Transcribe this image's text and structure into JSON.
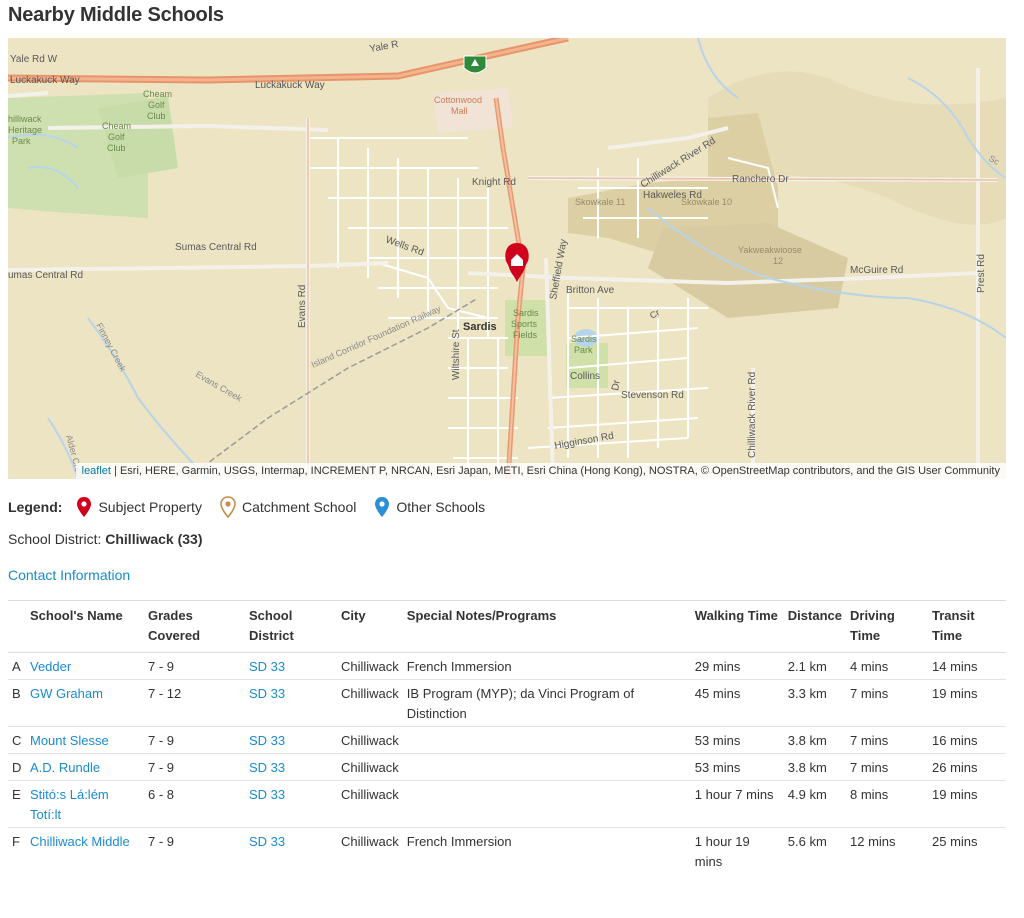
{
  "page": {
    "title": "Nearby Middle Schools"
  },
  "map": {
    "attribution_link": "leaflet",
    "attribution_text": " | Esri, HERE, Garmin, USGS, Intermap, INCREMENT P, NRCAN, Esri Japan, METI, Esri China (Hong Kong), NOSTRA, © OpenStreetMap contributors, and the GIS User Community",
    "labels": {
      "yale_rd_w": "Yale Rd W",
      "yale_rd": "Yale R",
      "luckakuck_way_left": "Luckakuck Way",
      "luckakuck_way": "Luckakuck Way",
      "cheam_golf_club_1": [
        "Cheam",
        "Golf",
        "Club"
      ],
      "cheam_golf_club_2": [
        "Cheam",
        "Golf",
        "Club"
      ],
      "heritage_park": [
        "hilliwack",
        "Heritage",
        "Park"
      ],
      "cottonwood_mall": [
        "Cottonwood",
        "Mall"
      ],
      "chilliwack_river_rd": "Chilliwack River Rd",
      "ranchero_dr": "Ranchero Dr",
      "knight_rd": "Knight Rd",
      "hakweles_rd": "Hakweles Rd",
      "skowkale_11": "Skowkale 11",
      "skowkale_10": "Skowkale 10",
      "sumas_central_rd": "Sumas Central Rd",
      "sumas_central_rd_left": "umas Central Rd",
      "wells_rd": "Wells Rd",
      "yakweakwioose": [
        "Yakweakwioose",
        "12"
      ],
      "mcguire_rd": "McGuire Rd",
      "prest_rd": "Prest Rd",
      "evans_rd": "Evans Rd",
      "sheffield_way": "Sheffield Way",
      "britton_ave": "Britton Ave",
      "island_corridor": "Island Corridor Foundation Railway",
      "sardis": "Sardis",
      "sardis_sports_fields": [
        "Sardis",
        "Sports",
        "Fields"
      ],
      "sardis_park": [
        "Sardis",
        "Park"
      ],
      "wiltshire_st": "Wiltshire St",
      "collins": "Collins",
      "dr": "Dr",
      "stevenson_rd": "Stevenson Rd",
      "evans_creek": "Evans Creek",
      "finney_creek": "Finney Creek",
      "chilliwack_river_rd_s": "Chilliwack River Rd",
      "higginson_rd": "Higginson Rd",
      "se_corner": "Sc",
      "alder_creek": "Alder Creek",
      "cr": "Cr"
    }
  },
  "legend": {
    "title": "Legend:",
    "items": [
      {
        "label": "Subject Property",
        "icon": "red-marker-icon",
        "color": "#d0021b"
      },
      {
        "label": "Catchment School",
        "icon": "orange-marker-icon",
        "color": "#c98a4b"
      },
      {
        "label": "Other Schools",
        "icon": "blue-marker-icon",
        "color": "#2b8fd6"
      }
    ]
  },
  "district": {
    "label": "School District:",
    "value": "Chilliwack (33)"
  },
  "contact": {
    "label": "Contact Information"
  },
  "table": {
    "headers": {
      "name": "School's Name",
      "grades": [
        "Grades",
        "Covered"
      ],
      "district": [
        "School",
        "District"
      ],
      "city": "City",
      "notes": "Special Notes/Programs",
      "walking": "Walking Time",
      "distance": "Distance",
      "driving": [
        "Driving",
        "Time"
      ],
      "transit": [
        "Transit",
        "Time"
      ]
    },
    "rows": [
      {
        "letter": "A",
        "name": "Vedder",
        "grades": "7 - 9",
        "district": "SD 33",
        "city": "Chilliwack",
        "notes": "French Immersion",
        "walking": "29 mins",
        "distance": "2.1 km",
        "driving": "4 mins",
        "transit": "14 mins"
      },
      {
        "letter": "B",
        "name": "GW Graham",
        "grades": "7 - 12",
        "district": "SD 33",
        "city": "Chilliwack",
        "notes": "IB Program (MYP); da Vinci Program of Distinction",
        "walking": "45 mins",
        "distance": "3.3 km",
        "driving": "7 mins",
        "transit": "19 mins"
      },
      {
        "letter": "C",
        "name": "Mount Slesse",
        "grades": "7 - 9",
        "district": "SD 33",
        "city": "Chilliwack",
        "notes": "",
        "walking": "53 mins",
        "distance": "3.8 km",
        "driving": "7 mins",
        "transit": "16 mins"
      },
      {
        "letter": "D",
        "name": "A.D. Rundle",
        "grades": "7 - 9",
        "district": "SD 33",
        "city": "Chilliwack",
        "notes": "",
        "walking": "53 mins",
        "distance": "3.8 km",
        "driving": "7 mins",
        "transit": "26 mins"
      },
      {
        "letter": "E",
        "name": "Stitó:s Lá:lém Totí:lt",
        "grades": "6 - 8",
        "district": "SD 33",
        "city": "Chilliwack",
        "notes": "",
        "walking": "1 hour 7 mins",
        "distance": "4.9 km",
        "driving": "8 mins",
        "transit": "19 mins"
      },
      {
        "letter": "F",
        "name": "Chilliwack Middle",
        "grades": "7 - 9",
        "district": "SD 33",
        "city": "Chilliwack",
        "notes": "French Immersion",
        "walking": "1 hour 19 mins",
        "distance": "5.6 km",
        "driving": "12 mins",
        "transit": "25 mins"
      }
    ]
  }
}
